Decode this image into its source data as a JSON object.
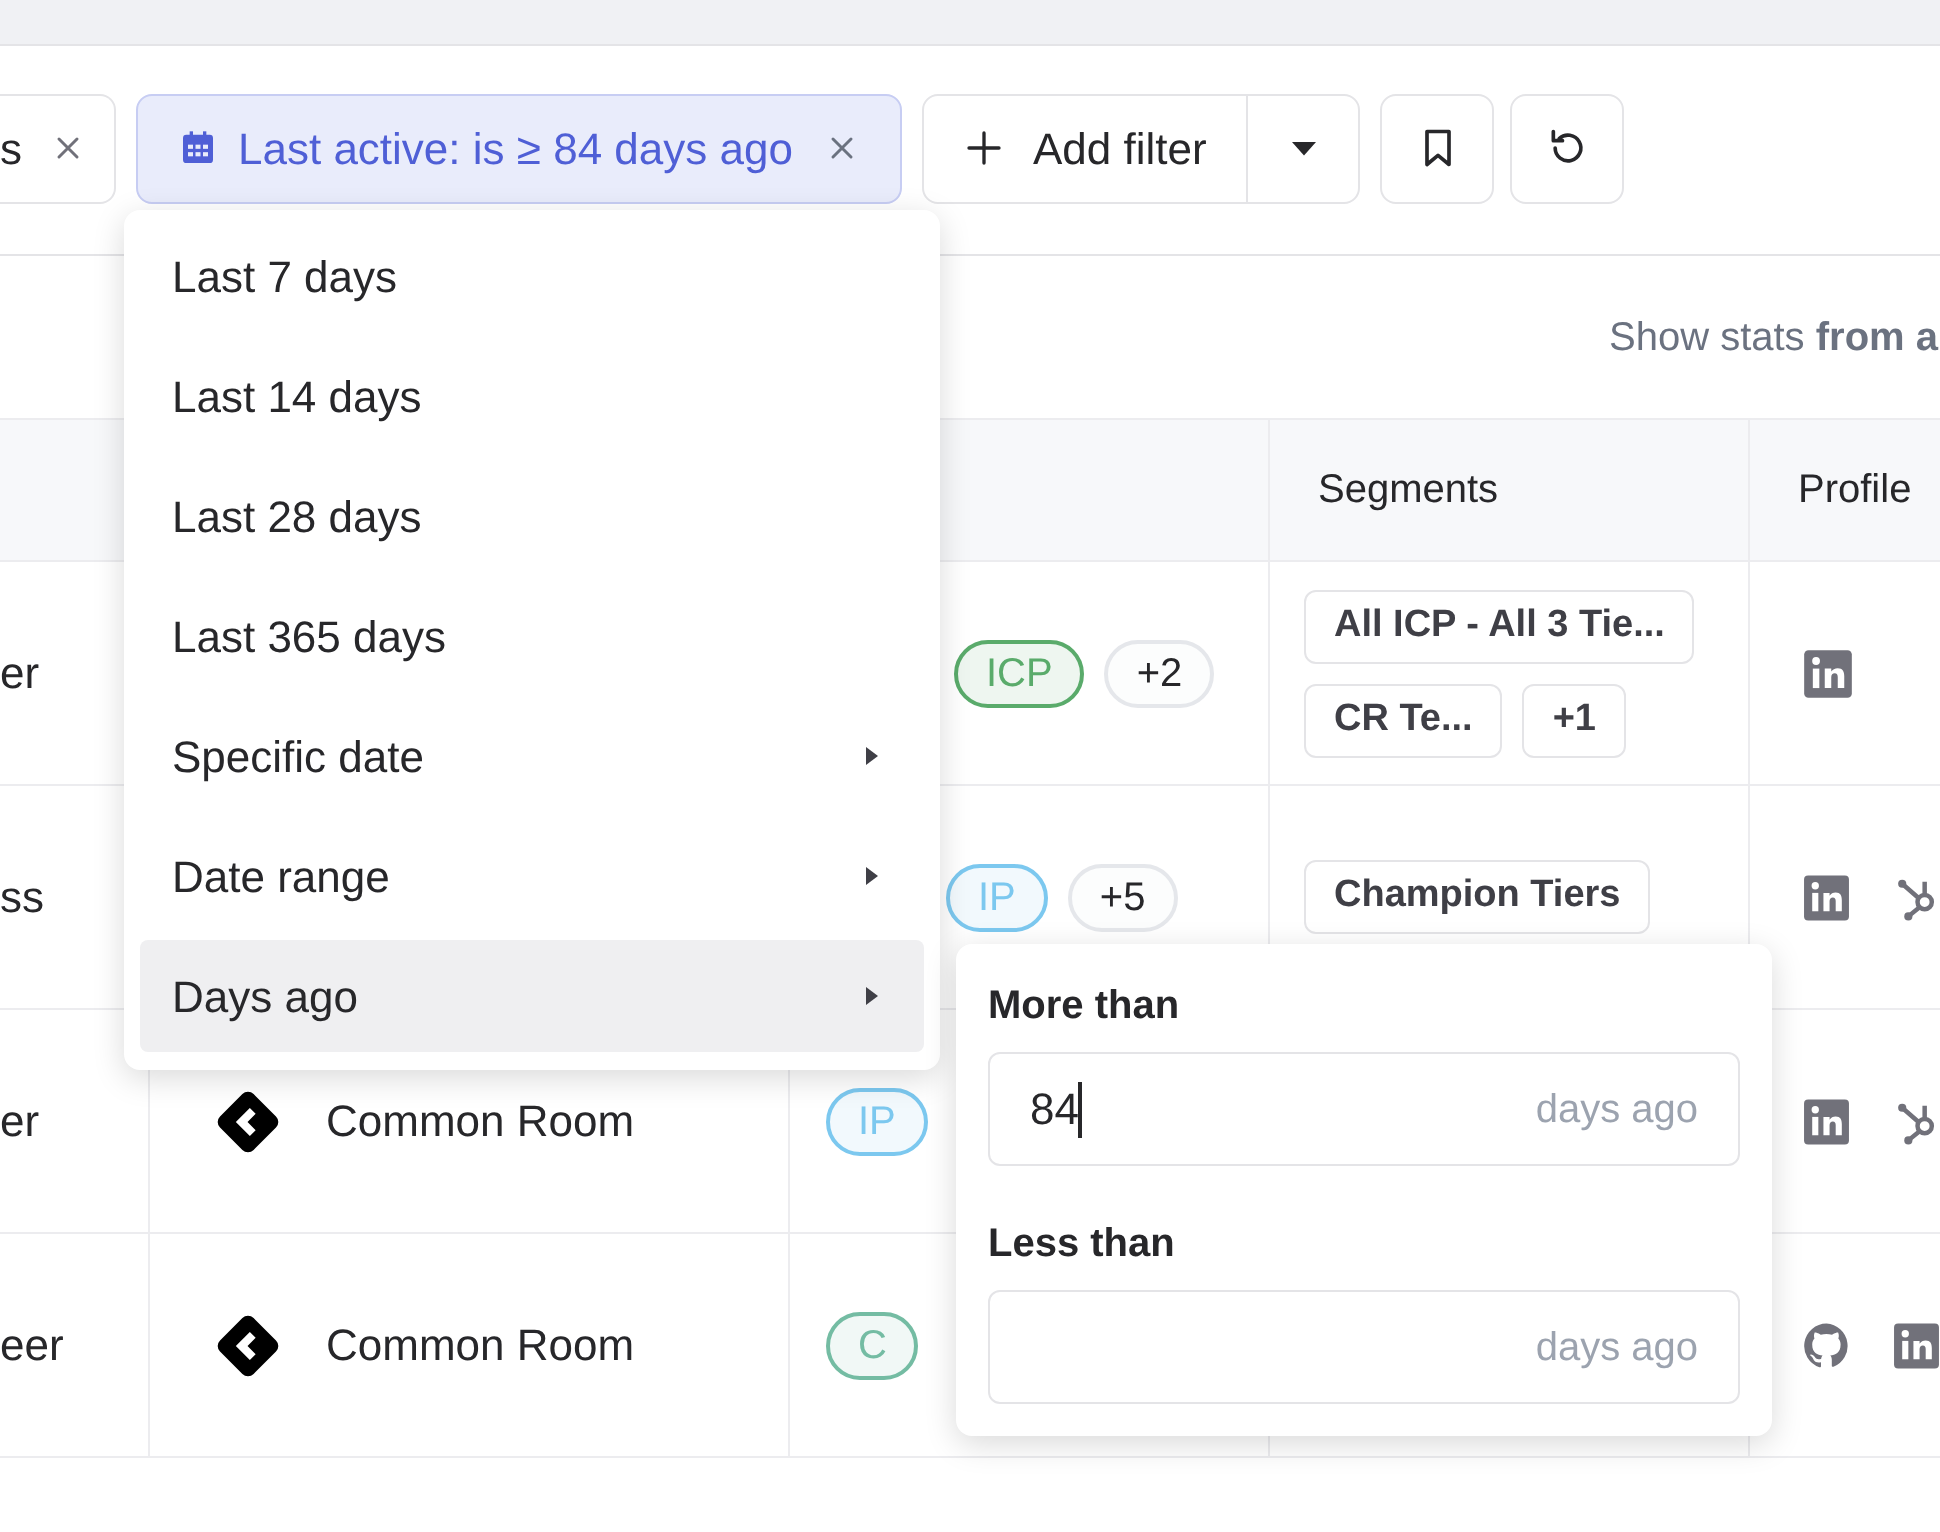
{
  "filter_bar": {
    "partial_chip": {
      "label": "s"
    },
    "active_chip": {
      "label": "Last active: is ≥ 84 days ago"
    },
    "add_filter": {
      "label": "Add filter"
    }
  },
  "stats_label": "Show stats **from a**",
  "table": {
    "columns": [
      "Segments",
      "Profile"
    ],
    "rows": [
      {
        "column_1": "er",
        "tags": [
          {
            "label": "ICP",
            "color": "#5aab6b"
          },
          {
            "label": "+2",
            "color": "#e5e7eb"
          }
        ],
        "segments": [
          "All ICP - All 3 Tie...",
          "CR Te...",
          "+1"
        ],
        "profiles": [
          {
            "kind": "linkedin"
          }
        ]
      },
      {
        "column_1": "ss",
        "tags": [
          {
            "label": "IP",
            "color": "#7cc8ef"
          },
          {
            "label": "+5",
            "color": "#e5e7eb"
          }
        ],
        "segments": [
          "Champion Tiers"
        ],
        "profiles": [
          {
            "kind": "linkedin"
          },
          {
            "kind": "hubspot"
          }
        ]
      },
      {
        "column_1": "er",
        "company": "Common Room",
        "tags": [
          {
            "label": "IP",
            "color": "#7cc8ef"
          }
        ],
        "profiles": [
          {
            "kind": "linkedin"
          },
          {
            "kind": "hubspot"
          }
        ]
      },
      {
        "column_1": "eer",
        "company": "Common Room",
        "tags": [
          {
            "label": "C",
            "color": "#74bca3"
          }
        ],
        "profiles": [
          {
            "kind": "github"
          },
          {
            "kind": "linkedin"
          }
        ]
      }
    ]
  },
  "date_menu": {
    "items": [
      {
        "label": "Last 7 days",
        "has_submenu": false,
        "selected": false
      },
      {
        "label": "Last 14 days",
        "has_submenu": false,
        "selected": false
      },
      {
        "label": "Last 28 days",
        "has_submenu": false,
        "selected": false
      },
      {
        "label": "Last 365 days",
        "has_submenu": false,
        "selected": false
      },
      {
        "label": "Specific date",
        "has_submenu": true,
        "selected": false
      },
      {
        "label": "Date range",
        "has_submenu": true,
        "selected": false
      },
      {
        "label": "Days ago",
        "has_submenu": true,
        "selected": true
      }
    ]
  },
  "days_ago_panel": {
    "fields": [
      {
        "label": "More than",
        "value": "84",
        "suffix": "days ago",
        "focused": true
      },
      {
        "label": "Less than",
        "suffix": "days ago",
        "focused": false
      }
    ]
  }
}
